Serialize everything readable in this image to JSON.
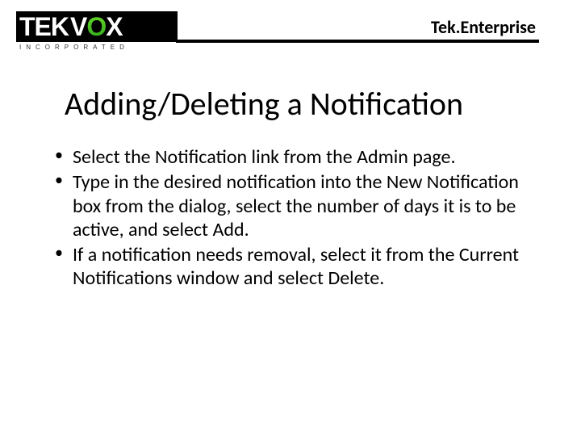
{
  "header": {
    "logo": {
      "tek": "TEK",
      "v": "V",
      "o": "O",
      "x": "X",
      "subline": "INCORPORATED"
    },
    "brand": "Tek.Enterprise"
  },
  "title": "Adding/Deleting a Notification",
  "bullets": [
    "Select the Notification link from the Admin page.",
    "Type in the desired notification into the New Notification box from the dialog, select the number of days it is to be active, and select Add.",
    "If a notification needs removal, select it from the Current Notifications window and select Delete."
  ]
}
